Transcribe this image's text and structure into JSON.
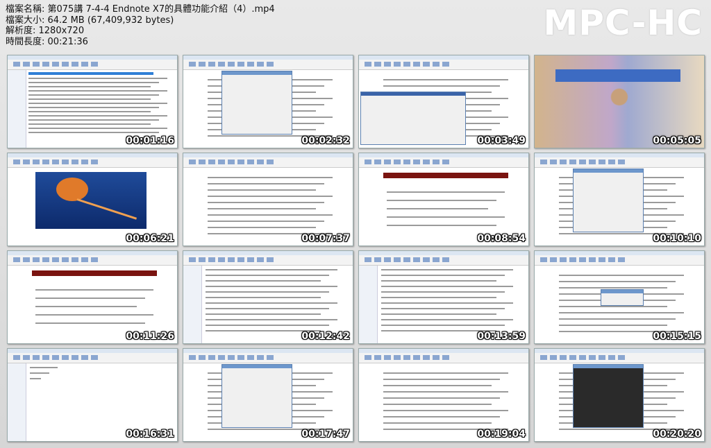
{
  "header": {
    "filename_label": "檔案名稱: 第075講 7-4-4  Endnote X7的具體功能介紹（4）.mp4",
    "size_label": "檔案大小: 64.2 MB (67,409,932 bytes)",
    "resolution_label": "解析度: 1280x720",
    "duration_label": "時間長度: 00:21:36"
  },
  "logo": "MPC-HC",
  "thumbnails": [
    {
      "timestamp": "00:01:16",
      "kind": "endnote-list"
    },
    {
      "timestamp": "00:02:32",
      "kind": "word-dialog"
    },
    {
      "timestamp": "00:03:49",
      "kind": "word-endnote"
    },
    {
      "timestamp": "00:05:05",
      "kind": "photo"
    },
    {
      "timestamp": "00:06:21",
      "kind": "jellyfish"
    },
    {
      "timestamp": "00:07:37",
      "kind": "word-text"
    },
    {
      "timestamp": "00:08:54",
      "kind": "word-red"
    },
    {
      "timestamp": "00:10:10",
      "kind": "word-dialog"
    },
    {
      "timestamp": "00:11:26",
      "kind": "word-red"
    },
    {
      "timestamp": "00:12:42",
      "kind": "endnote-edit"
    },
    {
      "timestamp": "00:13:59",
      "kind": "endnote-edit"
    },
    {
      "timestamp": "00:15:15",
      "kind": "word-dialog-small"
    },
    {
      "timestamp": "00:16:31",
      "kind": "endnote-blank"
    },
    {
      "timestamp": "00:17:47",
      "kind": "word-dialog"
    },
    {
      "timestamp": "00:19:04",
      "kind": "word-text"
    },
    {
      "timestamp": "00:20:20",
      "kind": "word-dark-dialog"
    }
  ]
}
